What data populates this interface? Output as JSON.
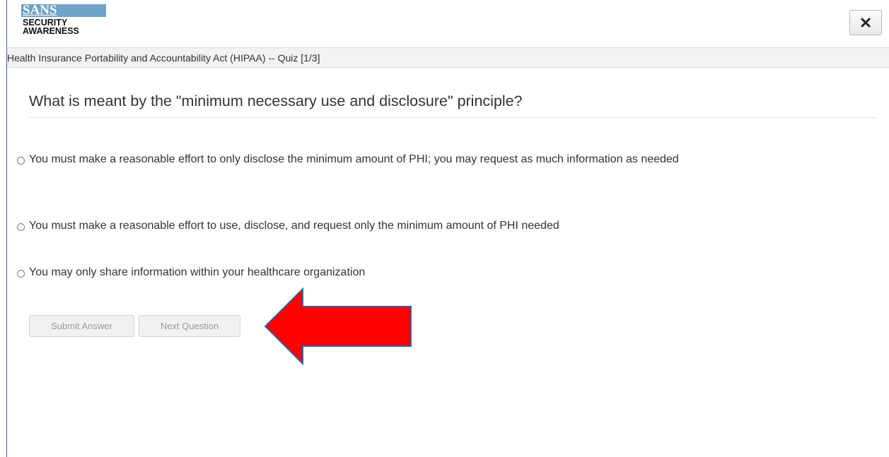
{
  "logo": {
    "brand": "SANS",
    "line1": "SECURITY",
    "line2": "AWARENESS"
  },
  "window": {
    "close_icon": "close-x-icon"
  },
  "course": {
    "title": "Health Insurance Portability and Accountability Act (HIPAA) -- Quiz [1/3]"
  },
  "quiz": {
    "question": "What is meant by the \"minimum necessary use and disclosure\" principle?",
    "options": [
      {
        "label": "You must make a reasonable effort to only disclose the minimum amount of PHI; you may request as much information as needed",
        "selected": false
      },
      {
        "label": "You must make a reasonable effort to use, disclose, and request only the minimum amount of PHI needed",
        "selected": false
      },
      {
        "label": "You may only share information within your healthcare organization",
        "selected": false
      }
    ]
  },
  "actions": {
    "submit_label": "Submit Answer",
    "next_label": "Next Question"
  },
  "annotation": {
    "arrow_color": "#ff0000",
    "arrow_outline": "#3b5fa0",
    "arrow_icon": "left-arrow-icon"
  },
  "colors": {
    "logo_band": "#6fa3c9",
    "title_bar": "#f2f2f2",
    "text": "#333333"
  }
}
